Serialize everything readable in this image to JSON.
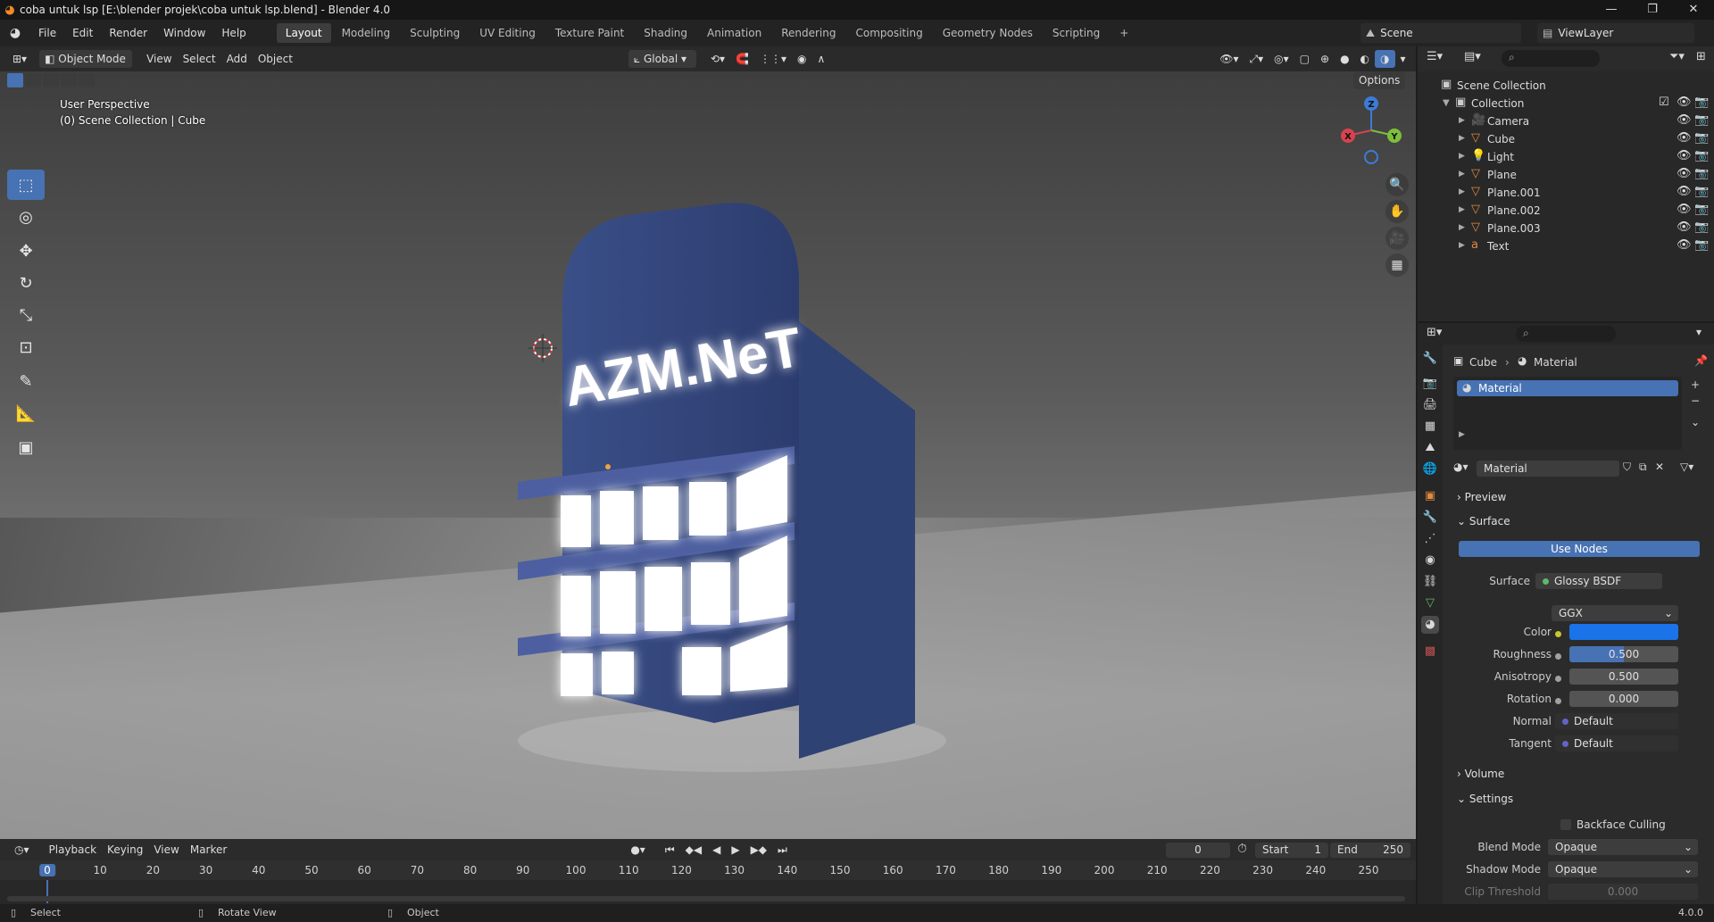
{
  "window": {
    "title": "coba untuk lsp [E:\\blender projek\\coba untuk lsp.blend] - Blender 4.0",
    "controls": [
      "—",
      "❐",
      "✕"
    ]
  },
  "menubar": {
    "menus": [
      "File",
      "Edit",
      "Render",
      "Window",
      "Help"
    ],
    "workspaces": [
      "Layout",
      "Modeling",
      "Sculpting",
      "UV Editing",
      "Texture Paint",
      "Shading",
      "Animation",
      "Rendering",
      "Compositing",
      "Geometry Nodes",
      "Scripting"
    ],
    "active_workspace": "Layout",
    "add_tab": "+",
    "scene": "Scene",
    "view_layer": "ViewLayer"
  },
  "viewport_header": {
    "mode": "Object Mode",
    "menus": [
      "View",
      "Select",
      "Add",
      "Object"
    ],
    "transform_orientation": "Global",
    "options": "Options"
  },
  "viewport": {
    "perspective": "User Perspective",
    "collection_info": "(0) Scene Collection | Cube",
    "sign_text": "AZM.NeT",
    "gizmo_axes": {
      "x": "X",
      "y": "Y",
      "z": "Z"
    }
  },
  "timeline": {
    "menus": [
      "Playback",
      "Keying",
      "View",
      "Marker"
    ],
    "current_frame": "0",
    "start_label": "Start",
    "start": "1",
    "end_label": "End",
    "end": "250",
    "ticks": [
      "0",
      "10",
      "20",
      "30",
      "40",
      "50",
      "60",
      "70",
      "80",
      "90",
      "100",
      "110",
      "120",
      "130",
      "140",
      "150",
      "160",
      "170",
      "180",
      "190",
      "200",
      "210",
      "220",
      "230",
      "240",
      "250"
    ]
  },
  "statusbar": {
    "select": "Select",
    "rotate": "Rotate View",
    "object": "Object",
    "version": "4.0.0"
  },
  "outliner": {
    "root": "Scene Collection",
    "collection": "Collection",
    "items": [
      {
        "name": "Camera",
        "icon": "camera-icon",
        "color": "#e08a3c"
      },
      {
        "name": "Cube",
        "icon": "mesh-icon",
        "color": "#e08a3c"
      },
      {
        "name": "Light",
        "icon": "light-icon",
        "color": "#e08a3c"
      },
      {
        "name": "Plane",
        "icon": "mesh-icon",
        "color": "#e08a3c"
      },
      {
        "name": "Plane.001",
        "icon": "mesh-icon",
        "color": "#e08a3c"
      },
      {
        "name": "Plane.002",
        "icon": "mesh-icon",
        "color": "#e08a3c"
      },
      {
        "name": "Plane.003",
        "icon": "mesh-icon",
        "color": "#e08a3c"
      },
      {
        "name": "Text",
        "icon": "text-icon",
        "color": "#e08a3c"
      }
    ]
  },
  "properties": {
    "breadcrumb_object": "Cube",
    "breadcrumb_tab": "Material",
    "slot_name": "Material",
    "material_name": "Material",
    "sections": {
      "preview": "Preview",
      "surface": "Surface",
      "volume": "Volume",
      "settings": "Settings"
    },
    "use_nodes": "Use Nodes",
    "surface_label": "Surface",
    "surface_value": "Glossy BSDF",
    "distribution": "GGX",
    "color_label": "Color",
    "color_value": "#1a73e8",
    "roughness_label": "Roughness",
    "roughness": "0.500",
    "anisotropy_label": "Anisotropy",
    "anisotropy": "0.500",
    "rotation_label": "Rotation",
    "rotation": "0.000",
    "normal_label": "Normal",
    "normal": "Default",
    "tangent_label": "Tangent",
    "tangent": "Default",
    "backface_culling": "Backface Culling",
    "blend_mode_label": "Blend Mode",
    "blend_mode": "Opaque",
    "shadow_mode_label": "Shadow Mode",
    "shadow_mode": "Opaque",
    "clip_threshold_label": "Clip Threshold",
    "clip_threshold": "0.000"
  },
  "colors": {
    "accent": "#4772b3",
    "object_orange": "#e08a3c",
    "mesh_green": "#5fb86b"
  }
}
